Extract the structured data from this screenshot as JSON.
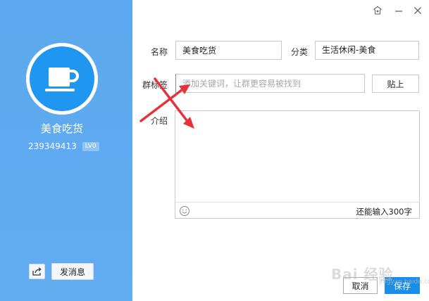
{
  "colors": {
    "sidebar": "#5ca9ef",
    "avatar_bg": "#1f96f0",
    "save_button": "#1a8de6",
    "annotation_arrow": "#e8323a"
  },
  "sidebar": {
    "avatar_icon": "coffee-cup-icon",
    "group_name": "美食吃货",
    "group_id": "239349413",
    "level": "LV0",
    "share_icon": "share-icon",
    "send_message_label": "发消息"
  },
  "window": {
    "skin_icon": "skin-icon",
    "minimize_icon": "minimize-icon",
    "close_icon": "close-icon"
  },
  "form": {
    "name_label": "名称",
    "name_value": "美食吃货",
    "category_label": "分类",
    "category_value": "生活休闲-美食",
    "tags_label": "群标签",
    "tags_placeholder": "添加关键词，让群更容易被找到",
    "paste_label": "贴上",
    "intro_label": "介绍",
    "emoji_icon": "smiley-icon",
    "char_count": "还能输入300字"
  },
  "footer": {
    "cancel_label": "取消",
    "save_label": "保存"
  },
  "watermark": {
    "text": "Bai 经验",
    "sub": "jingyan.baidu.com"
  }
}
